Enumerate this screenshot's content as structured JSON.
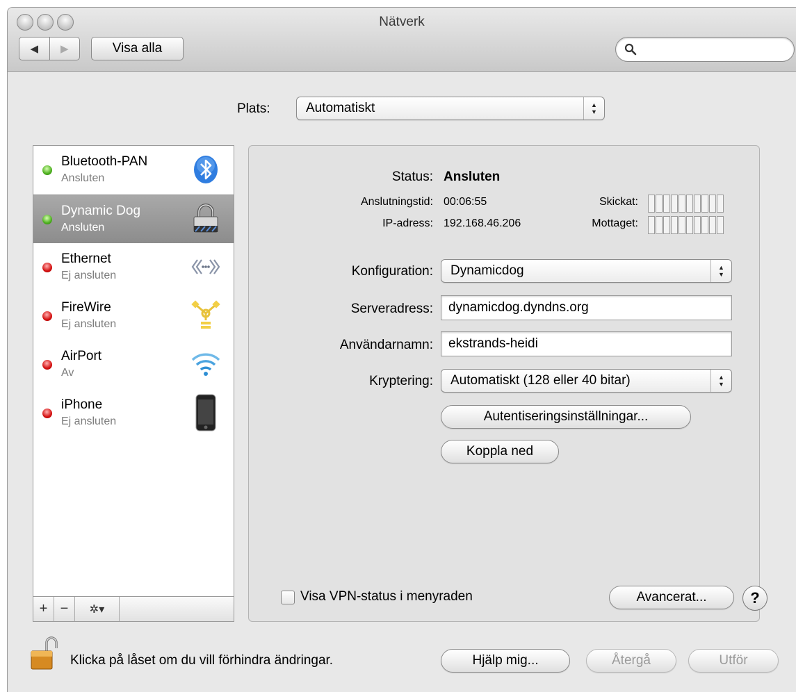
{
  "window": {
    "title": "Nätverk"
  },
  "toolbar": {
    "show_all": "Visa alla",
    "search_placeholder": ""
  },
  "location": {
    "label": "Plats:",
    "value": "Automatiskt"
  },
  "services": [
    {
      "name": "Bluetooth-PAN",
      "status": "Ansluten",
      "state": "green",
      "icon": "bluetooth-icon"
    },
    {
      "name": "Dynamic Dog",
      "status": "Ansluten",
      "state": "green",
      "icon": "vpn-lock-icon",
      "selected": true
    },
    {
      "name": "Ethernet",
      "status": "Ej ansluten",
      "state": "red",
      "icon": "ethernet-icon"
    },
    {
      "name": "FireWire",
      "status": "Ej ansluten",
      "state": "red",
      "icon": "firewire-icon"
    },
    {
      "name": "AirPort",
      "status": "Av",
      "state": "red",
      "icon": "airport-wifi-icon"
    },
    {
      "name": "iPhone",
      "status": "Ej ansluten",
      "state": "red",
      "icon": "iphone-icon"
    }
  ],
  "sidebar_buttons": {
    "add": "+",
    "remove": "−",
    "action": "✲▾"
  },
  "detail": {
    "status_label": "Status:",
    "status_value": "Ansluten",
    "conn_time_label": "Anslutningstid:",
    "conn_time_value": "00:06:55",
    "ip_label": "IP-adress:",
    "ip_value": "192.168.46.206",
    "sent_label": "Skickat:",
    "received_label": "Mottaget:",
    "config_label": "Konfiguration:",
    "config_value": "Dynamicdog",
    "server_label": "Serveradress:",
    "server_value": "dynamicdog.dyndns.org",
    "user_label": "Användarnamn:",
    "user_value": "ekstrands-heidi",
    "encryption_label": "Kryptering:",
    "encryption_value": "Automatiskt (128 eller 40 bitar)",
    "auth_button": "Autentiseringsinställningar...",
    "disconnect_button": "Koppla ned",
    "vpn_status_checkbox": "Visa VPN-status i menyraden",
    "advanced_button": "Avancerat...",
    "help_symbol": "?"
  },
  "footer": {
    "lock_text": "Klicka på låset om du vill förhindra ändringar.",
    "assist_button": "Hjälp mig...",
    "revert_button": "Återgå",
    "apply_button": "Utför"
  },
  "colors": {
    "connected": "#4caf1e",
    "disconnected": "#d41010",
    "selection": "#8c8c8c"
  }
}
